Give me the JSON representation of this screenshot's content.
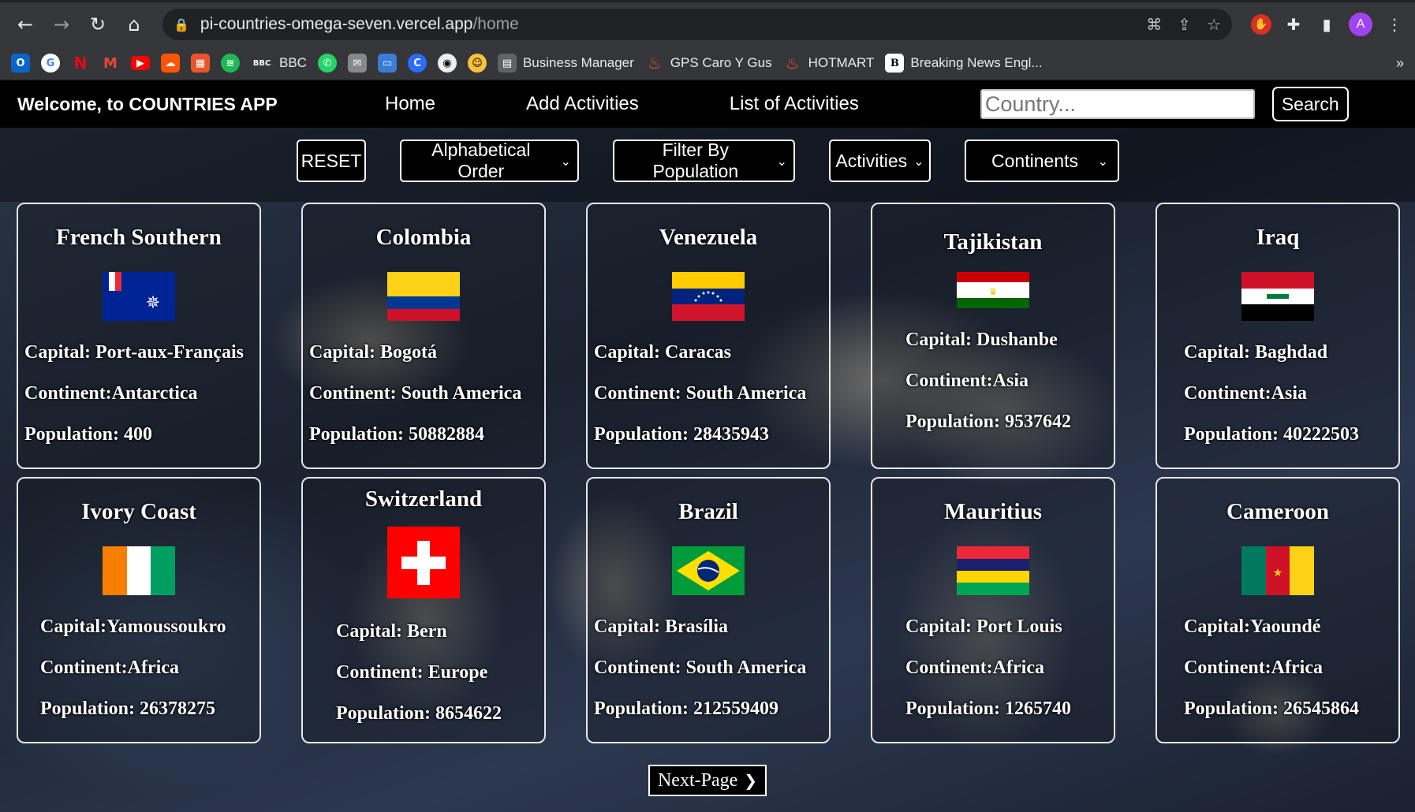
{
  "browser": {
    "url_host": "pi-countries-omega-seven.vercel.app",
    "url_path": "/home",
    "avatar_letter": "A",
    "bookmarks": [
      "BBC",
      "Business Manager",
      "GPS Caro Y Gus",
      "HOTMART",
      "Breaking News Engl..."
    ],
    "more_label": "»"
  },
  "navbar": {
    "brand": "Welcome, to COUNTRIES APP",
    "links": [
      "Home",
      "Add Activities",
      "List of Activities"
    ],
    "search_placeholder": "Country...",
    "search_button": "Search"
  },
  "filters": {
    "reset": "RESET",
    "alphabetical": "Alphabetical Order",
    "population": "Filter By Population",
    "activities": "Activities",
    "continents": "Continents"
  },
  "countries": [
    {
      "name": "French Southern",
      "capital": "Capital: Port-aux-Français",
      "continent": "Continent:Antarctica",
      "population": "Population: 400"
    },
    {
      "name": "Colombia",
      "capital": "Capital: Bogotá",
      "continent": "Continent: South America",
      "population": "Population: 50882884"
    },
    {
      "name": "Venezuela",
      "capital": "Capital: Caracas",
      "continent": "Continent: South America",
      "population": "Population: 28435943"
    },
    {
      "name": "Tajikistan",
      "capital": "Capital: Dushanbe",
      "continent": "Continent:Asia",
      "population": "Population: 9537642"
    },
    {
      "name": "Iraq",
      "capital": "Capital: Baghdad",
      "continent": "Continent:Asia",
      "population": "Population: 40222503"
    },
    {
      "name": "Ivory Coast",
      "capital": "Capital:Yamoussoukro",
      "continent": "Continent:Africa",
      "population": "Population: 26378275"
    },
    {
      "name": "Switzerland",
      "capital": "Capital: Bern",
      "continent": "Continent: Europe",
      "population": "Population: 8654622"
    },
    {
      "name": "Brazil",
      "capital": "Capital: Brasília",
      "continent": "Continent: South America",
      "population": "Population: 212559409"
    },
    {
      "name": "Mauritius",
      "capital": "Capital: Port Louis",
      "continent": "Continent:Africa",
      "population": "Population: 1265740"
    },
    {
      "name": "Cameroon",
      "capital": "Capital:Yaoundé",
      "continent": "Continent:Africa",
      "population": "Population: 26545864"
    }
  ],
  "pagination": {
    "next": "Next-Page"
  },
  "colors": {
    "navbar": "#000000",
    "card_border": "#e6e6e6",
    "accent": "#ffffff"
  }
}
